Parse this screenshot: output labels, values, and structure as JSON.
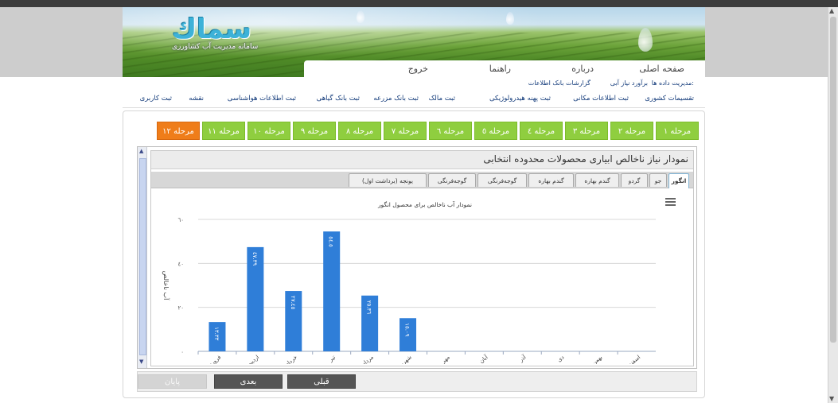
{
  "app": {
    "logo_text": "سماك",
    "logo_subtitle": "سامانه مدیریت آب کشاورزی"
  },
  "main_nav": {
    "home": "صفحه اصلی",
    "about": "درباره",
    "help": "راهنما",
    "logout": "خروج"
  },
  "sub_nav_row1": [
    "مدیریت داده ها:",
    "برآورد نیاز آبی",
    "گزارشات بانک اطلاعات"
  ],
  "sub_nav_row2": [
    "تقسیمات کشوری",
    "ثبت اطلاعات مکانی",
    "ثبت پهنه هیدرولوژیکی",
    "ثبت مالک",
    "ثبت بانک مزرعه",
    "ثبت بانک گیاهی",
    "ثبت اطلاعات هواشناسی",
    "نقشه",
    "ثبت کاربری"
  ],
  "steps": [
    "مرحله ۱",
    "مرحله ۲",
    "مرحله ۳",
    "مرحله ٤",
    "مرحله ٥",
    "مرحله ٦",
    "مرحله ۷",
    "مرحله ۸",
    "مرحله ۹",
    "مرحله ۱۰",
    "مرحله ۱۱",
    "مرحله ۱۲"
  ],
  "active_step": "مرحله ۱۲",
  "panel_title": "نمودار نیاز ناخالص ابیاری محصولات محدوده انتخابی",
  "crop_tabs": [
    "انگور",
    "جو",
    "گردو",
    "گندم بهاره",
    "گندم بهاره",
    "گوجه‌فرنگی",
    "گوجه‌فرنگی",
    "یونجه (برداشت اول)"
  ],
  "active_tab": "انگور",
  "colors": {
    "step_green": "#8fce3f",
    "step_active_orange": "#ef7d1a",
    "bar_blue": "#2f7ed8"
  },
  "chart_data": {
    "type": "bar",
    "title": "نمودار آب ناخالص برای محصول انگور",
    "ylabel": "آب ناخالص",
    "xlabel": "",
    "ylim": [
      0,
      60
    ],
    "y_ticks": [
      "۰",
      "۲۰",
      "٤۰",
      "٦۰"
    ],
    "categories": [
      "فروردین",
      "اردیبهشت",
      "خرداد",
      "تیر",
      "مرداد",
      "شهریور",
      "مهر",
      "آبان",
      "آذر",
      "دی",
      "بهمن",
      "اسفند"
    ],
    "values": [
      13.33,
      47.39,
      27.45,
      54.5,
      25.36,
      15.09,
      null,
      null,
      null,
      null,
      null,
      null
    ],
    "value_labels": [
      "۱۳.۳۳",
      "٤۷.۳۹",
      "۲۷.٤٥",
      "٥٤.٥",
      "۲٥.۳٦",
      "۱٥.۰۹",
      "",
      "",
      "",
      "",
      "",
      ""
    ],
    "grid": true,
    "legend": "none"
  },
  "buttons": {
    "prev": "قبلی",
    "next": "بعدی",
    "finish": "پایان"
  }
}
